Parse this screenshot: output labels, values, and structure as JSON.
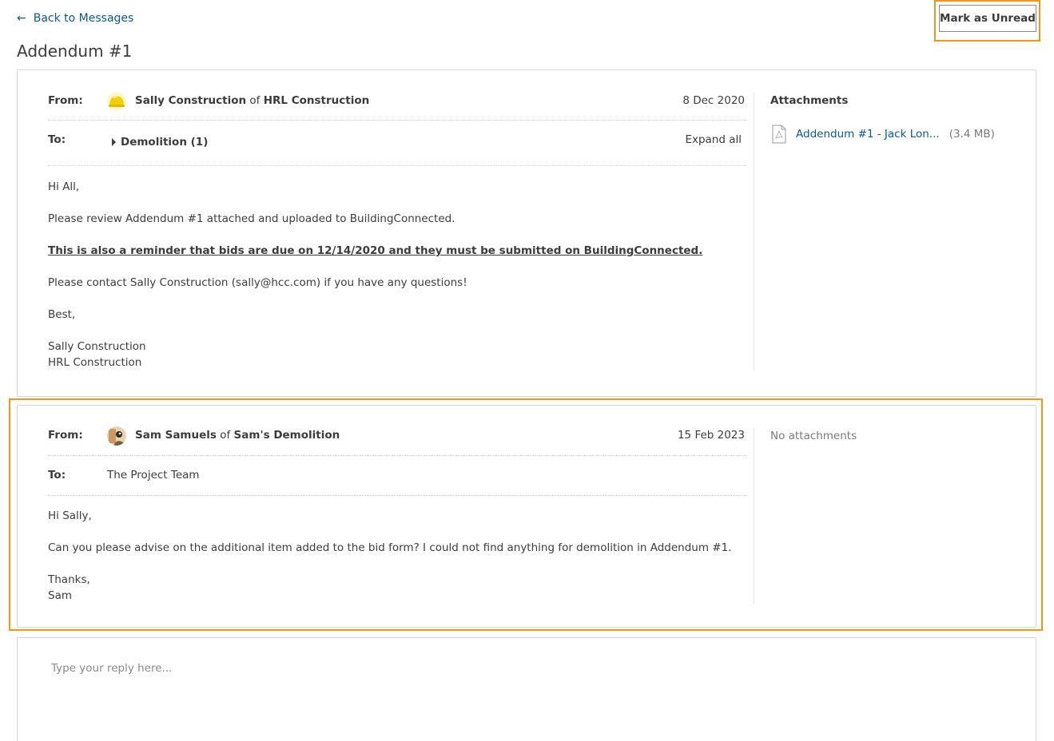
{
  "nav": {
    "back_label": "Back to Messages",
    "back_icon": "arrow-left-icon"
  },
  "toolbar": {
    "mark_unread_label": "Mark as Unread"
  },
  "page": {
    "title": "Addendum #1"
  },
  "colors": {
    "link": "#0a5a96",
    "highlight": "#f7941d"
  },
  "messages": [
    {
      "from_label": "From:",
      "sender_name": "Sally Construction",
      "sender_of": "of",
      "sender_company": "HRL Construction",
      "date": "8 Dec 2020",
      "to_label": "To:",
      "to_group": "Demolition (1)",
      "expand_all": "Expand all",
      "body": {
        "greeting": "Hi All,",
        "line1": "Please review Addendum #1 attached and uploaded to BuildingConnected.",
        "line2": "This is also a reminder that bids are due on 12/14/2020 and they must be submitted on BuildingConnected.",
        "line3": "Please contact Sally Construction (sally@hcc.com) if you have any questions!",
        "signoff": "Best,",
        "sig_name": "Sally Construction",
        "sig_company": "HRL Construction"
      },
      "attachments_title": "Attachments",
      "attachment": {
        "name": "Addendum #1 - Jack Lon...",
        "size": "(3.4 MB)",
        "icon": "pdf-file-icon"
      }
    },
    {
      "from_label": "From:",
      "sender_name": "Sam Samuels",
      "sender_of": "of",
      "sender_company": "Sam's Demolition",
      "date": "15 Feb 2023",
      "to_label": "To:",
      "to_text": "The Project Team",
      "body": {
        "greeting": "Hi Sally,",
        "line1": "Can you please advise on the additional item added to the bid form? I could not find anything for demolition in Addendum #1.",
        "signoff": "Thanks,",
        "sig_name": "Sam"
      },
      "no_attachments": "No attachments"
    }
  ],
  "reply": {
    "placeholder": "Type your reply here..."
  }
}
